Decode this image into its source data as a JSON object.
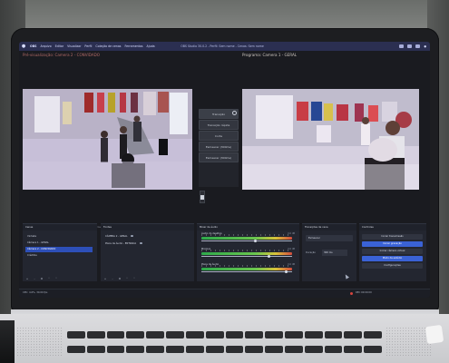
{
  "menu": {
    "items": [
      "OBS",
      "Arquivo",
      "Editar",
      "Visualizar",
      "Perfil",
      "Coleção de cenas",
      "Ferramentas",
      "Ajuda"
    ],
    "window_title": "OBS Studio 30.0.2 - Perfil: Sem nome - Cenas: Sem nome"
  },
  "panels": {
    "preview_title": "Pré-visualização: Camera 2 - CONVIDADO",
    "program_title": "Programa: Camera 1 - GERAL"
  },
  "transition_buttons": [
    "Transição",
    "Transição rápida",
    "Corte",
    "Esmaecer (300ms)",
    "Esmaecer (300ms)"
  ],
  "tabs": [
    "Nenhuma fonte selecionada",
    "Propriedades",
    "Filtros"
  ],
  "docks": {
    "scenes": {
      "title": "Cenas",
      "items": [
        "Vinheta",
        "Câmera 1 - GERAL",
        "Câmera 2 - CONVIDADO",
        "Créditos"
      ],
      "selected_index": 2
    },
    "sources": {
      "title": "Fontes",
      "items": [
        "CÂMERA 2 - GERAL",
        "Placa de Áudio - ENTRADA"
      ]
    },
    "audio": {
      "title": "Mixer de áudio",
      "channels": [
        {
          "name": "Áudio do desktop",
          "db": "0.0 dB",
          "level": 0.58
        },
        {
          "name": "Mic/Aux",
          "db": "0.0 dB",
          "level": 0.73
        },
        {
          "name": "Placa de Áudio",
          "db": "0.0 dB",
          "level": 0.92
        }
      ]
    },
    "transitions": {
      "title": "Transições de cena",
      "selected": "Esmaecer",
      "duration_label": "Duração",
      "duration_value": "300 ms"
    },
    "controls": {
      "title": "Controles",
      "buttons": [
        "Iniciar transmissão",
        "Iniciar gravação",
        "Iniciar câmera virtual",
        "Modo de estúdio",
        "Configurações"
      ]
    }
  },
  "status": {
    "left": "CPU: 4.6%, 30.00 fps",
    "right": "REC 00:00:00"
  },
  "colors": {
    "accent": "#3a62d6",
    "highlight": "#2d4fb8",
    "title_red": "#b26a66"
  }
}
